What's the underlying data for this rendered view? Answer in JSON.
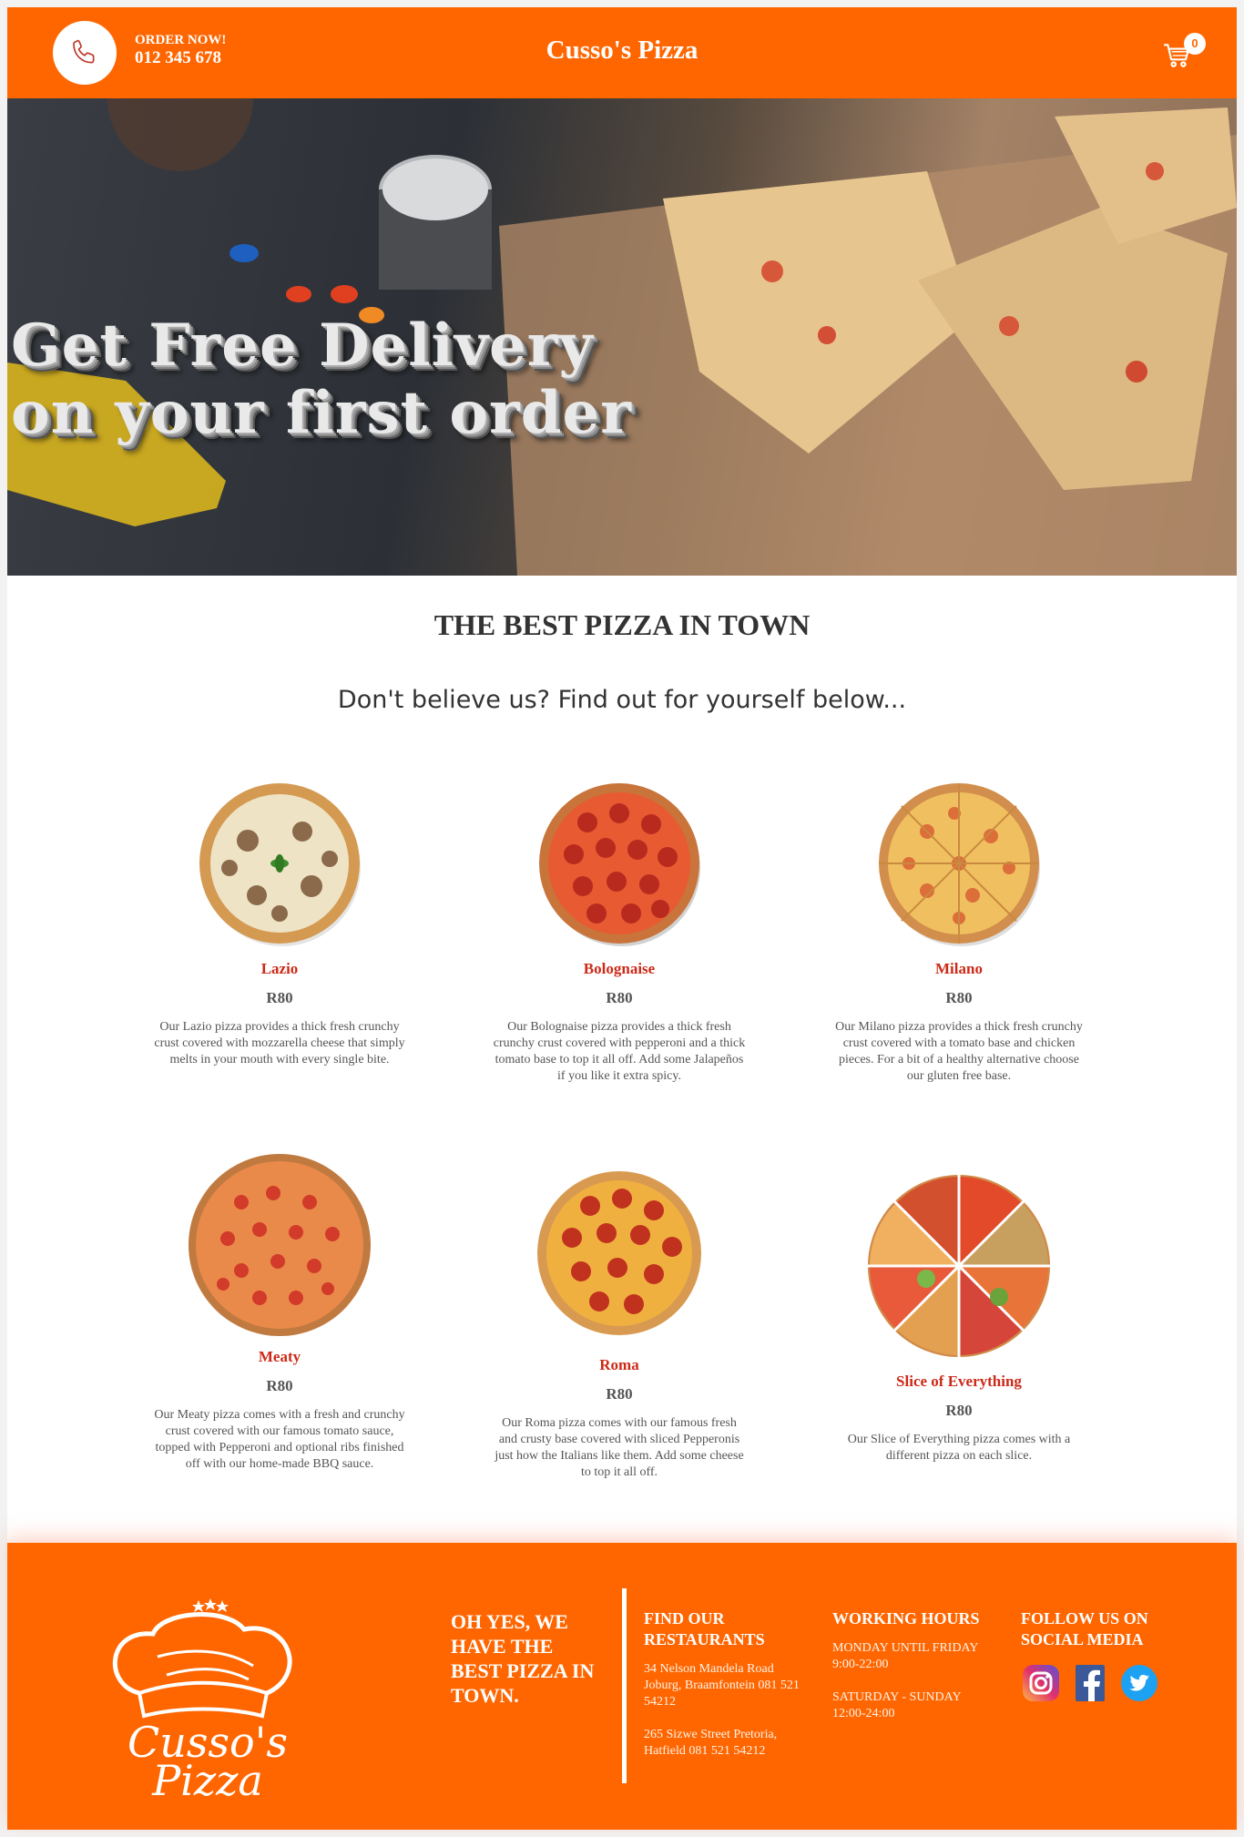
{
  "header": {
    "order_label": "ORDER NOW!",
    "phone": "012 345 678",
    "brand": "Cusso's Pizza",
    "cart_count": "0"
  },
  "hero": {
    "line1": "Get Free Delivery",
    "line2": "on your first order"
  },
  "main": {
    "title": "THE BEST PIZZA IN TOWN",
    "subtitle": "Don't believe us? Find out for yourself below..."
  },
  "pizzas": [
    {
      "name": "Lazio",
      "price": "R80",
      "description": "Our Lazio pizza provides a thick fresh crunchy crust covered with mozzarella cheese that simply melts in your mouth with every single bite."
    },
    {
      "name": "Bolognaise",
      "price": "R80",
      "description": "Our Bolognaise pizza provides a thick fresh crunchy crust covered with pepperoni and a thick tomato base to top it all off. Add some Jalapeños if you like it extra spicy."
    },
    {
      "name": "Milano",
      "price": "R80",
      "description": "Our Milano pizza provides a thick fresh crunchy crust covered with a tomato base and chicken pieces. For a bit of a healthy alternative choose our gluten free base."
    },
    {
      "name": "Meaty",
      "price": "R80",
      "description": "Our Meaty pizza comes with a fresh and crunchy crust covered with our famous tomato sauce, topped with Pepperoni and optional ribs finished off with our home-made BBQ sauce."
    },
    {
      "name": "Roma",
      "price": "R80",
      "description": "Our Roma pizza comes with our famous fresh and crusty base covered with sliced Pepperonis just how the Italians like them. Add some cheese to top it all off."
    },
    {
      "name": "Slice of Everything",
      "price": "R80",
      "description": "Our Slice of Everything pizza comes with a different pizza on each slice."
    }
  ],
  "footer": {
    "logo_text": "Cusso's Pizza",
    "tagline": "OH YES, WE HAVE THE BEST PIZZA IN TOWN.",
    "restaurants": {
      "heading": "FIND OUR RESTAURANTS",
      "address1": "34 Nelson Mandela Road Joburg, Braamfontein 081 521 54212",
      "address2": "265 Sizwe Street Pretoria, Hatfield 081 521 54212"
    },
    "hours": {
      "heading": "WORKING HOURS",
      "weekday": "MONDAY UNTIL FRIDAY 9:00-22:00",
      "weekend": "SATURDAY - SUNDAY 12:00-24:00"
    },
    "social": {
      "heading": "FOLLOW US ON SOCIAL MEDIA",
      "icons": [
        "instagram-icon",
        "facebook-icon",
        "twitter-icon"
      ]
    }
  },
  "colors": {
    "brand_orange": "#ff6600",
    "pizza_name_red": "#cc2a18"
  }
}
